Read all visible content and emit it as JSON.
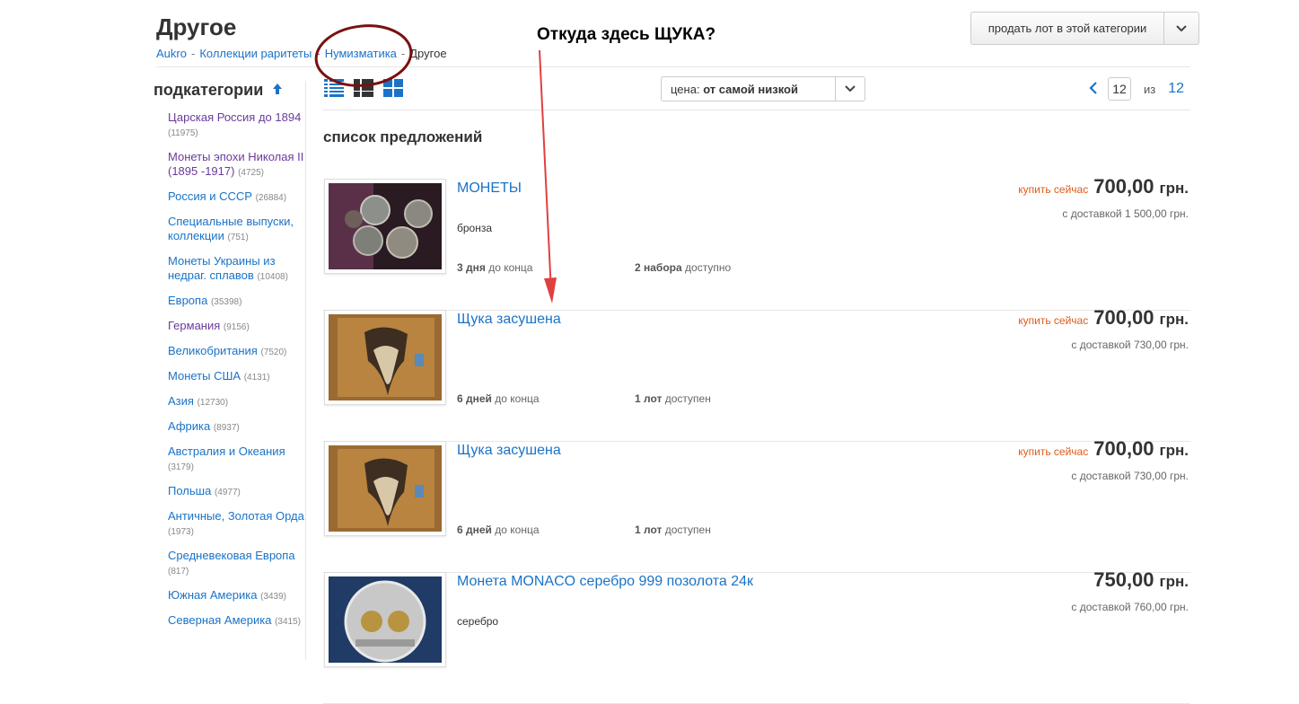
{
  "header": {
    "title": "Другое",
    "breadcrumb": [
      {
        "label": "Aukro"
      },
      {
        "label": "Коллекции раритеты"
      },
      {
        "label": "Нумизматика"
      },
      {
        "label": "Другое"
      }
    ],
    "separator": "-",
    "sell_button": "продать лот в этой категории"
  },
  "annotation": {
    "text": "Откуда здесь ЩУКА?",
    "circle_color": "#7a1010",
    "arrow_color": "#e04040"
  },
  "sidebar": {
    "title": "подкатегории",
    "items": [
      {
        "label": "Царская Россия до 1894",
        "count": "(11975)",
        "visited": true
      },
      {
        "label": "Монеты эпохи Николая II (1895 -1917)",
        "count": "(4725)",
        "visited": true
      },
      {
        "label": "Россия и СССР",
        "count": "(26884)",
        "visited": false
      },
      {
        "label": "Специальные выпуски, коллекции",
        "count": "(751)",
        "visited": false
      },
      {
        "label": "Монеты Украины из недраг. сплавов",
        "count": "(10408)",
        "visited": false
      },
      {
        "label": "Европа",
        "count": "(35398)",
        "visited": false
      },
      {
        "label": "Германия",
        "count": "(9156)",
        "visited": true
      },
      {
        "label": "Великобритания",
        "count": "(7520)",
        "visited": false
      },
      {
        "label": "Монеты США",
        "count": "(4131)",
        "visited": false
      },
      {
        "label": "Азия",
        "count": "(12730)",
        "visited": false
      },
      {
        "label": "Африка",
        "count": "(8937)",
        "visited": false
      },
      {
        "label": "Австралия и Океания",
        "count": "(3179)",
        "visited": false
      },
      {
        "label": "Польша",
        "count": "(4977)",
        "visited": false
      },
      {
        "label": "Античные, Золотая Орда",
        "count": "(1973)",
        "visited": false
      },
      {
        "label": "Средневековая Европа",
        "count": "(817)",
        "visited": false
      },
      {
        "label": "Южная Америка",
        "count": "(3439)",
        "visited": false
      },
      {
        "label": "Северная Америка",
        "count": "(3415)",
        "visited": false
      }
    ]
  },
  "toolbar": {
    "sort_prefix": "цена:",
    "sort_value": "от самой низкой",
    "current_page": "12",
    "of_label": "из",
    "total_pages": "12"
  },
  "list": {
    "title": "список предложений",
    "items": [
      {
        "title": "МОНЕТЫ",
        "desc": "бронза",
        "ends_bold": "3 дня",
        "ends_rest": "до конца",
        "avail_bold": "2 набора",
        "avail_rest": "доступно",
        "buy_label": "купить сейчас",
        "price": "700,00",
        "currency": "грн.",
        "delivery": "с доставкой 1 500,00 грн.",
        "image": "coins"
      },
      {
        "title": "Щука засушена",
        "desc": "",
        "ends_bold": "6 дней",
        "ends_rest": "до конца",
        "avail_bold": "1 лот",
        "avail_rest": "доступен",
        "buy_label": "купить сейчас",
        "price": "700,00",
        "currency": "грн.",
        "delivery": "с доставкой 730,00 грн.",
        "image": "pike"
      },
      {
        "title": "Щука засушена",
        "desc": "",
        "ends_bold": "6 дней",
        "ends_rest": "до конца",
        "avail_bold": "1 лот",
        "avail_rest": "доступен",
        "buy_label": "купить сейчас",
        "price": "700,00",
        "currency": "грн.",
        "delivery": "с доставкой 730,00 грн.",
        "image": "pike"
      },
      {
        "title": "Монета MONACO серебро 999 позолота 24к",
        "desc": "серебро",
        "ends_bold": "",
        "ends_rest": "",
        "avail_bold": "",
        "avail_rest": "",
        "buy_label": "",
        "price": "750,00",
        "currency": "грн.",
        "delivery": "с доставкой 760,00 грн.",
        "image": "monaco"
      }
    ]
  }
}
